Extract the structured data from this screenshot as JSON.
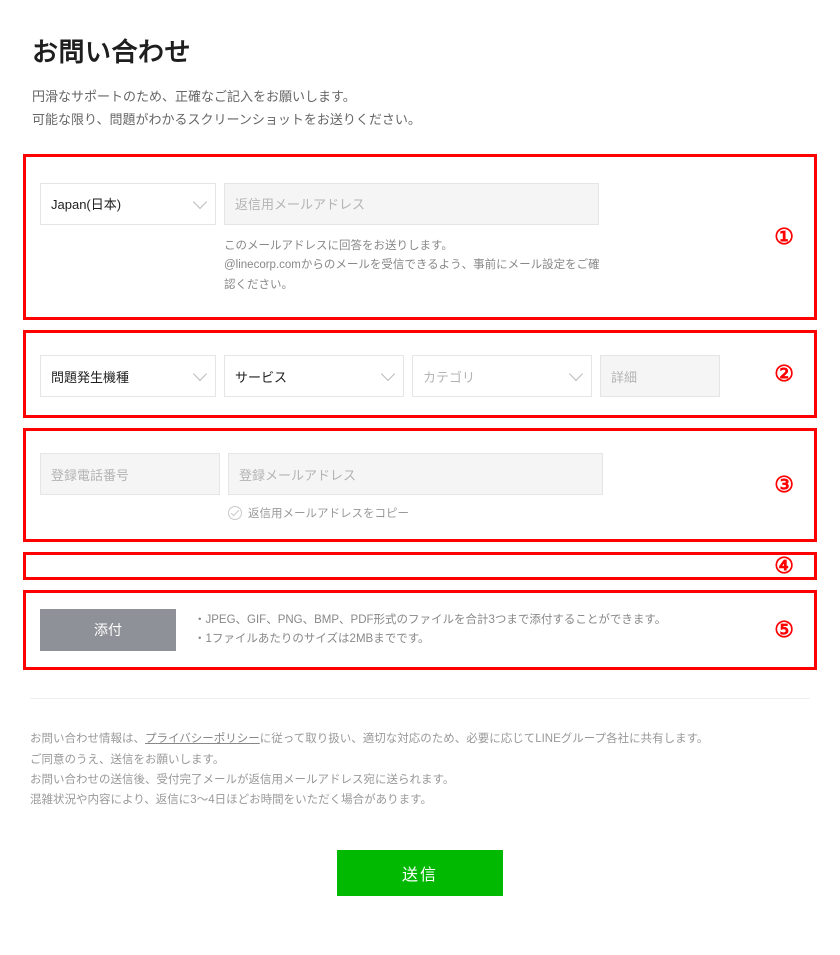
{
  "header": {
    "title": "お問い合わせ",
    "subtitle_line1": "円滑なサポートのため、正確なご記入をお願いします。",
    "subtitle_line2": "可能な限り、問題がわかるスクリーンショットをお送りください。"
  },
  "markers": {
    "m1": "①",
    "m2": "②",
    "m3": "③",
    "m4": "④",
    "m5": "⑤"
  },
  "section1": {
    "country_value": "Japan(日本)",
    "reply_email_placeholder": "返信用メールアドレス",
    "hint_line1": "このメールアドレスに回答をお送りします。",
    "hint_line2": "@linecorp.comからのメールを受信できるよう、事前にメール設定をご確認ください。"
  },
  "section2": {
    "model_value": "問題発生機種",
    "service_value": "サービス",
    "category_placeholder": "カテゴリ",
    "detail_placeholder": "詳細"
  },
  "section3": {
    "phone_placeholder": "登録電話番号",
    "regmail_placeholder": "登録メールアドレス",
    "copy_radio_label": "返信用メールアドレスをコピー"
  },
  "section5": {
    "attach_label": "添付",
    "note1": "・JPEG、GIF、PNG、BMP、PDF形式のファイルを合計3つまで添付することができます。",
    "note2": "・1ファイルあたりのサイズは2MBまでです。"
  },
  "policy": {
    "line1a": "お問い合わせ情報は、",
    "privacy_link": "プライバシーポリシー",
    "line1b": "に従って取り扱い、適切な対応のため、必要に応じてLINEグループ各社に共有します。",
    "line2": "ご同意のうえ、送信をお願いします。",
    "line3": "お問い合わせの送信後、受付完了メールが返信用メールアドレス宛に送られます。",
    "line4": "混雑状況や内容により、返信に3～4日ほどお時間をいただく場合があります。"
  },
  "submit": {
    "label": "送信"
  }
}
